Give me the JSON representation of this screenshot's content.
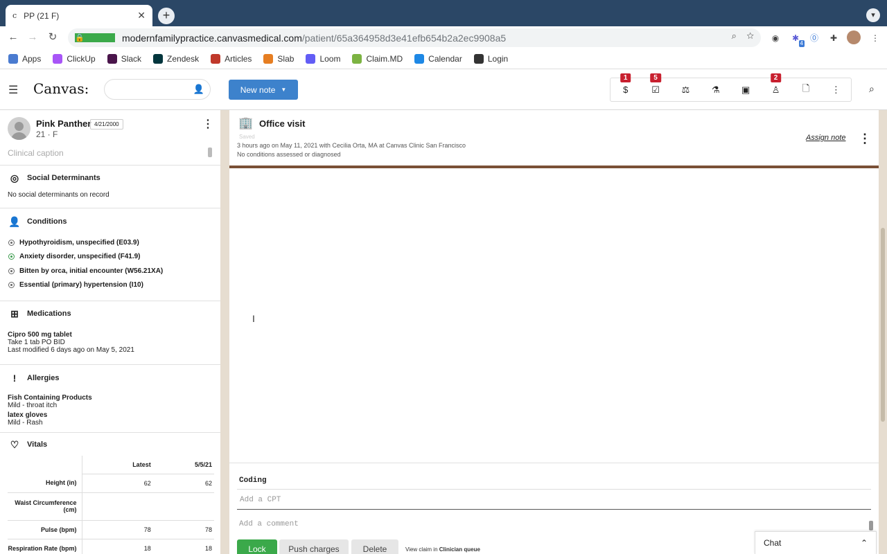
{
  "browser": {
    "tab_title": "PP (21 F)",
    "url_host": "modernfamilypractice.canvasmedical.com",
    "url_path": "/patient/65a364958d3e41efb654b2a2ec9908a5",
    "ext_badge": "4",
    "bookmarks": [
      {
        "label": "Apps",
        "color": "#4a7bd0"
      },
      {
        "label": "ClickUp",
        "color": "#a855f7"
      },
      {
        "label": "Slack",
        "color": "#4a154b"
      },
      {
        "label": "Zendesk",
        "color": "#03363d"
      },
      {
        "label": "Articles",
        "color": "#c0392b"
      },
      {
        "label": "Slab",
        "color": "#e67e22"
      },
      {
        "label": "Loom",
        "color": "#625df5"
      },
      {
        "label": "Claim.MD",
        "color": "#7cb342"
      },
      {
        "label": "Calendar",
        "color": "#1e88e5"
      },
      {
        "label": "Login",
        "color": "#333333"
      }
    ]
  },
  "app": {
    "logo": "Canvas:",
    "new_note_label": "New note",
    "badges": {
      "tasks": "1",
      "messages": "5",
      "refer": "2"
    }
  },
  "patient": {
    "name": "Pink Panther",
    "dob": "4/21/2000",
    "age_sex": "21 · F",
    "caption_placeholder": "Clinical caption"
  },
  "sections": {
    "social": {
      "title": "Social Determinants",
      "empty": "No social determinants on record"
    },
    "conditions": {
      "title": "Conditions",
      "items": [
        "Hypothyroidism, unspecified (E03.9)",
        "Anxiety disorder, unspecified (F41.9)",
        "Bitten by orca, initial encounter (W56.21XA)",
        "Essential (primary) hypertension (I10)"
      ]
    },
    "medications": {
      "title": "Medications",
      "name": "Cipro 500 mg tablet",
      "sig": "Take 1 tab PO BID",
      "modified": "Last modified 6 days ago on May 5, 2021"
    },
    "allergies": {
      "title": "Allergies",
      "items": [
        {
          "name": "Fish Containing Products",
          "reaction": "Mild - throat itch"
        },
        {
          "name": "latex gloves",
          "reaction": "Mild - Rash"
        }
      ]
    },
    "vitals": {
      "title": "Vitals",
      "columns": [
        "Latest",
        "5/5/21"
      ],
      "rows": [
        {
          "label": "Height (in)",
          "latest": "62",
          "prev": "62"
        },
        {
          "label": "Waist Circumference (cm)",
          "latest": "",
          "prev": ""
        },
        {
          "label": "Pulse (bpm)",
          "latest": "78",
          "prev": "78"
        },
        {
          "label": "Respiration Rate (bpm)",
          "latest": "18",
          "prev": "18"
        }
      ]
    }
  },
  "note": {
    "title": "Office visit",
    "status": "Saved",
    "meta": "3 hours ago on May 11, 2021 with Cecilia Orta, MA at Canvas Clinic San Francisco",
    "conditions_status": "No conditions assessed or diagnosed",
    "assign_label": "Assign note",
    "coding_label": "Coding",
    "cpt_placeholder": "Add a CPT",
    "comment_placeholder": "Add a comment",
    "lock_label": "Lock",
    "push_label": "Push charges",
    "delete_label": "Delete",
    "view_claim_prefix": "View claim in",
    "view_claim_queue": "Clinician queue"
  },
  "chat": {
    "label": "Chat"
  }
}
